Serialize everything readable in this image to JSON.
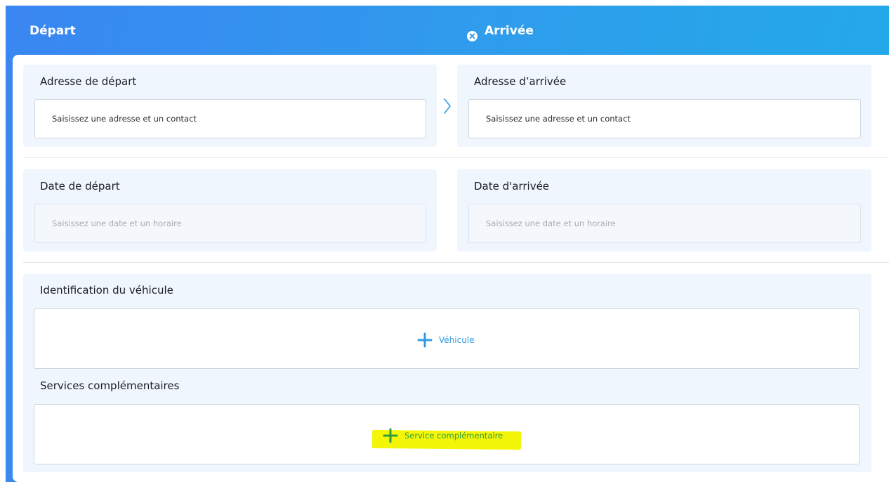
{
  "header": {
    "depart_label": "Départ",
    "arrivee_label": "Arrivée"
  },
  "cards": {
    "adresse_depart": {
      "title": "Adresse de départ",
      "placeholder": "Saisissez une adresse et un contact"
    },
    "adresse_arrivee": {
      "title": "Adresse d’arrivée",
      "placeholder": "Saisissez une adresse et un contact"
    },
    "date_depart": {
      "title": "Date de départ",
      "placeholder": "Saisissez une date et un horaire"
    },
    "date_arrivee": {
      "title": "Date d'arrivée",
      "placeholder": "Saisissez une date et un horaire"
    },
    "vehicule": {
      "title": "Identification du véhicule",
      "button_label": "Véhicule"
    },
    "services": {
      "title": "Services complémentaires",
      "button_label": "Service complémentaire"
    }
  },
  "icons": {
    "close": "close-circle-icon",
    "arrow": "chevron-right-icon",
    "add_vehicle": "plus-icon",
    "add_service": "plus-icon"
  },
  "colors": {
    "accent_blue": "#2f9ae2",
    "service_green": "#2f9e3a",
    "highlight_yellow": "#f4f60a",
    "card_bg": "#f0f6fe"
  }
}
